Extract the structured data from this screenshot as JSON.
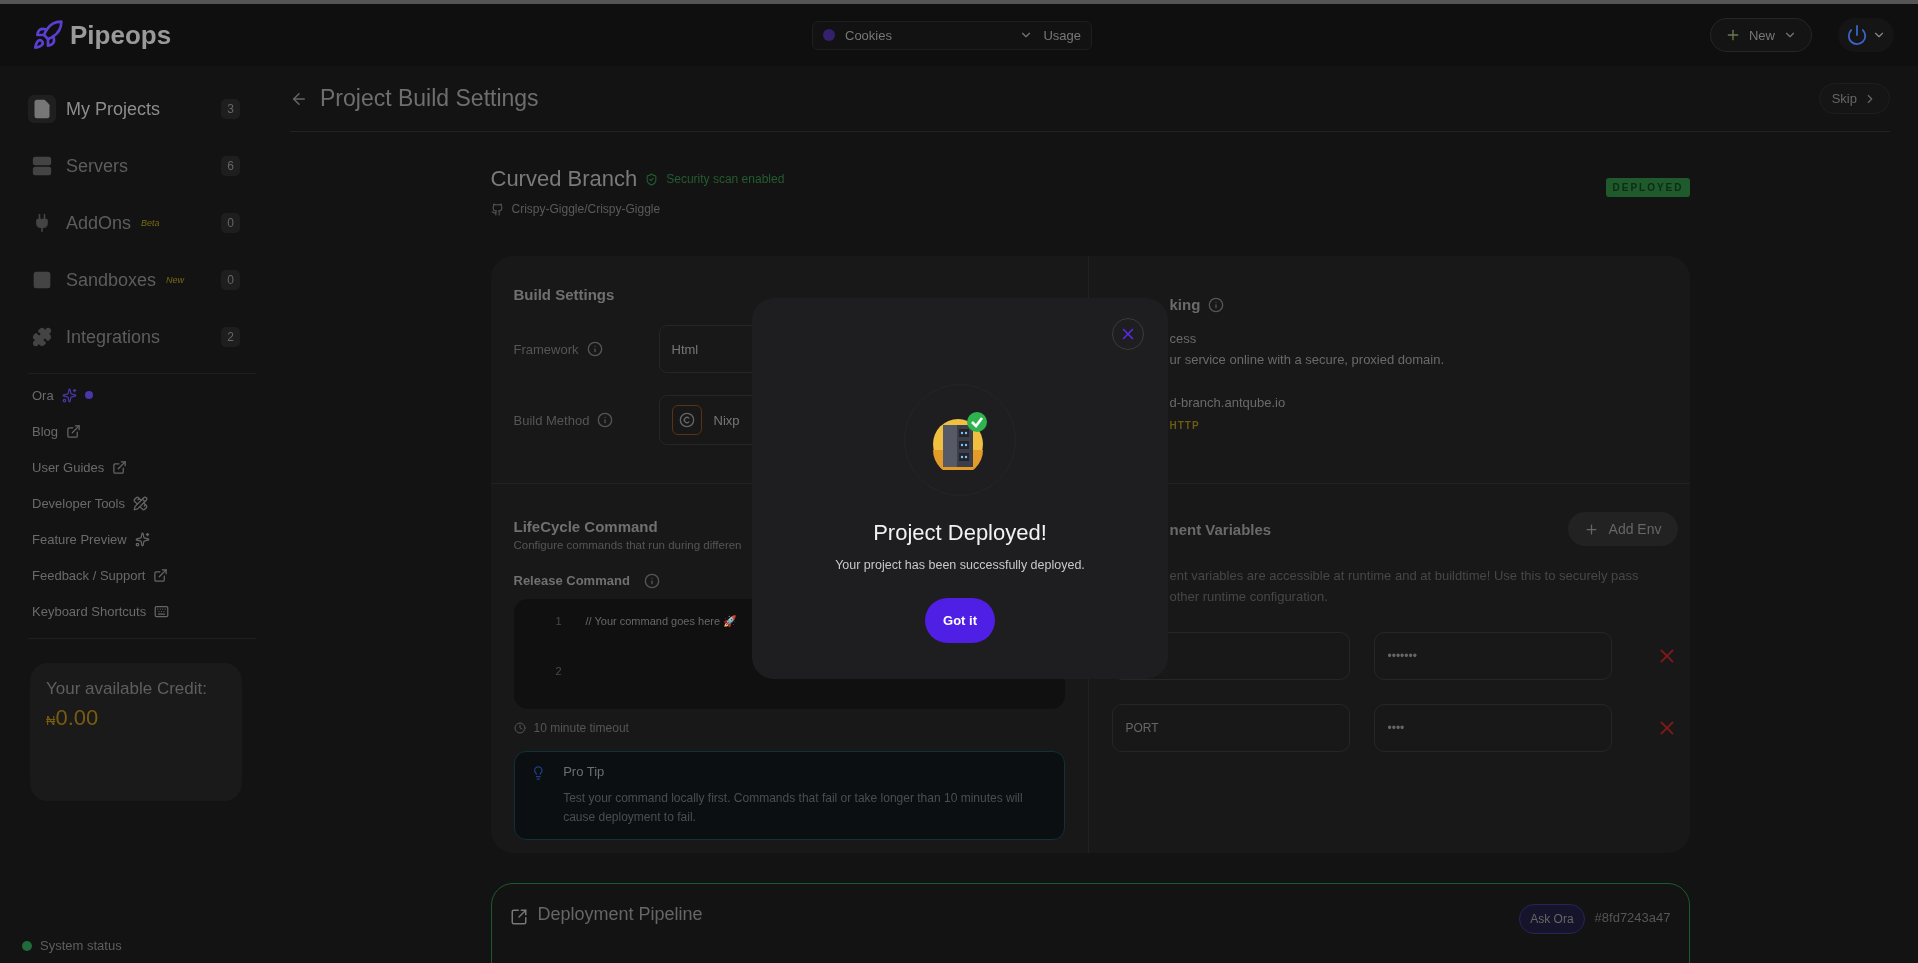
{
  "brand": {
    "name": "Pipeops"
  },
  "topbar": {
    "workspace": "Cookies",
    "usage": "Usage",
    "new_button": "New"
  },
  "sidebar": {
    "items": [
      {
        "label": "My Projects",
        "count": "3",
        "kind": "file",
        "selected": true
      },
      {
        "label": "Servers",
        "count": "6",
        "kind": "server",
        "selected": false
      },
      {
        "label": "AddOns",
        "tag": "Beta",
        "count": "0",
        "kind": "plug",
        "selected": false
      },
      {
        "label": "Sandboxes",
        "tag": "New",
        "count": "0",
        "kind": "box",
        "selected": false
      },
      {
        "label": "Integrations",
        "count": "2",
        "kind": "puzzle",
        "selected": false
      }
    ],
    "links": [
      {
        "label": "Ora",
        "kind": "ora"
      },
      {
        "label": "Blog",
        "kind": "external"
      },
      {
        "label": "User Guides",
        "kind": "external"
      },
      {
        "label": "Developer Tools",
        "kind": "tools"
      },
      {
        "label": "Feature Preview",
        "kind": "preview"
      },
      {
        "label": "Feedback / Support",
        "kind": "external"
      },
      {
        "label": "Keyboard Shortcuts",
        "kind": "keyboard"
      }
    ],
    "credit": {
      "label": "Your available Credit:",
      "currency": "₦",
      "amount": "0.00"
    },
    "system_status": "System status"
  },
  "header": {
    "title": "Project Build Settings",
    "skip": "Skip"
  },
  "project": {
    "name": "Curved Branch",
    "security": "Security scan enabled",
    "repo": "Crispy-Giggle/Crispy-Giggle",
    "status": "DEPLOYED"
  },
  "build": {
    "title": "Build Settings",
    "fields": [
      {
        "label": "Framework",
        "value": "Html",
        "kind": "text"
      },
      {
        "label": "Build Method",
        "value": "Nixp",
        "kind": "method"
      }
    ]
  },
  "lifecycle": {
    "title": "LifeCycle Command",
    "description": "Configure commands that run during differen",
    "release_label": "Release Command",
    "lines": [
      {
        "number": "1",
        "code": "// Your command goes here 🚀"
      },
      {
        "number": "2"
      }
    ],
    "timeout": "10 minute timeout",
    "tip_title": "Pro Tip",
    "tip_text": "Test your command locally first. Commands that fail or take longer than 10 minutes will cause deployment to fail."
  },
  "networking": {
    "title": "king",
    "access": "cess",
    "description": "ur service online with a secure, proxied domain.",
    "domain": "d-branch.antqube.io",
    "protocol": "HTTP"
  },
  "env": {
    "title": "nent Variables",
    "add_button": "Add Env",
    "description": "ent variables are accessible at runtime and at buildtime! Use this to securely pass",
    "description_2": "other runtime configuration.",
    "rows": [
      {
        "value": "•••••••"
      },
      {
        "key": "PORT",
        "value": "••••"
      }
    ]
  },
  "pipeline": {
    "title": "Deployment Pipeline",
    "ask": "Ask Ora",
    "commit": "#8fd7243a47"
  },
  "modal": {
    "title": "Project Deployed!",
    "message": "Your project has been successfully deployed.",
    "button": "Got it"
  }
}
